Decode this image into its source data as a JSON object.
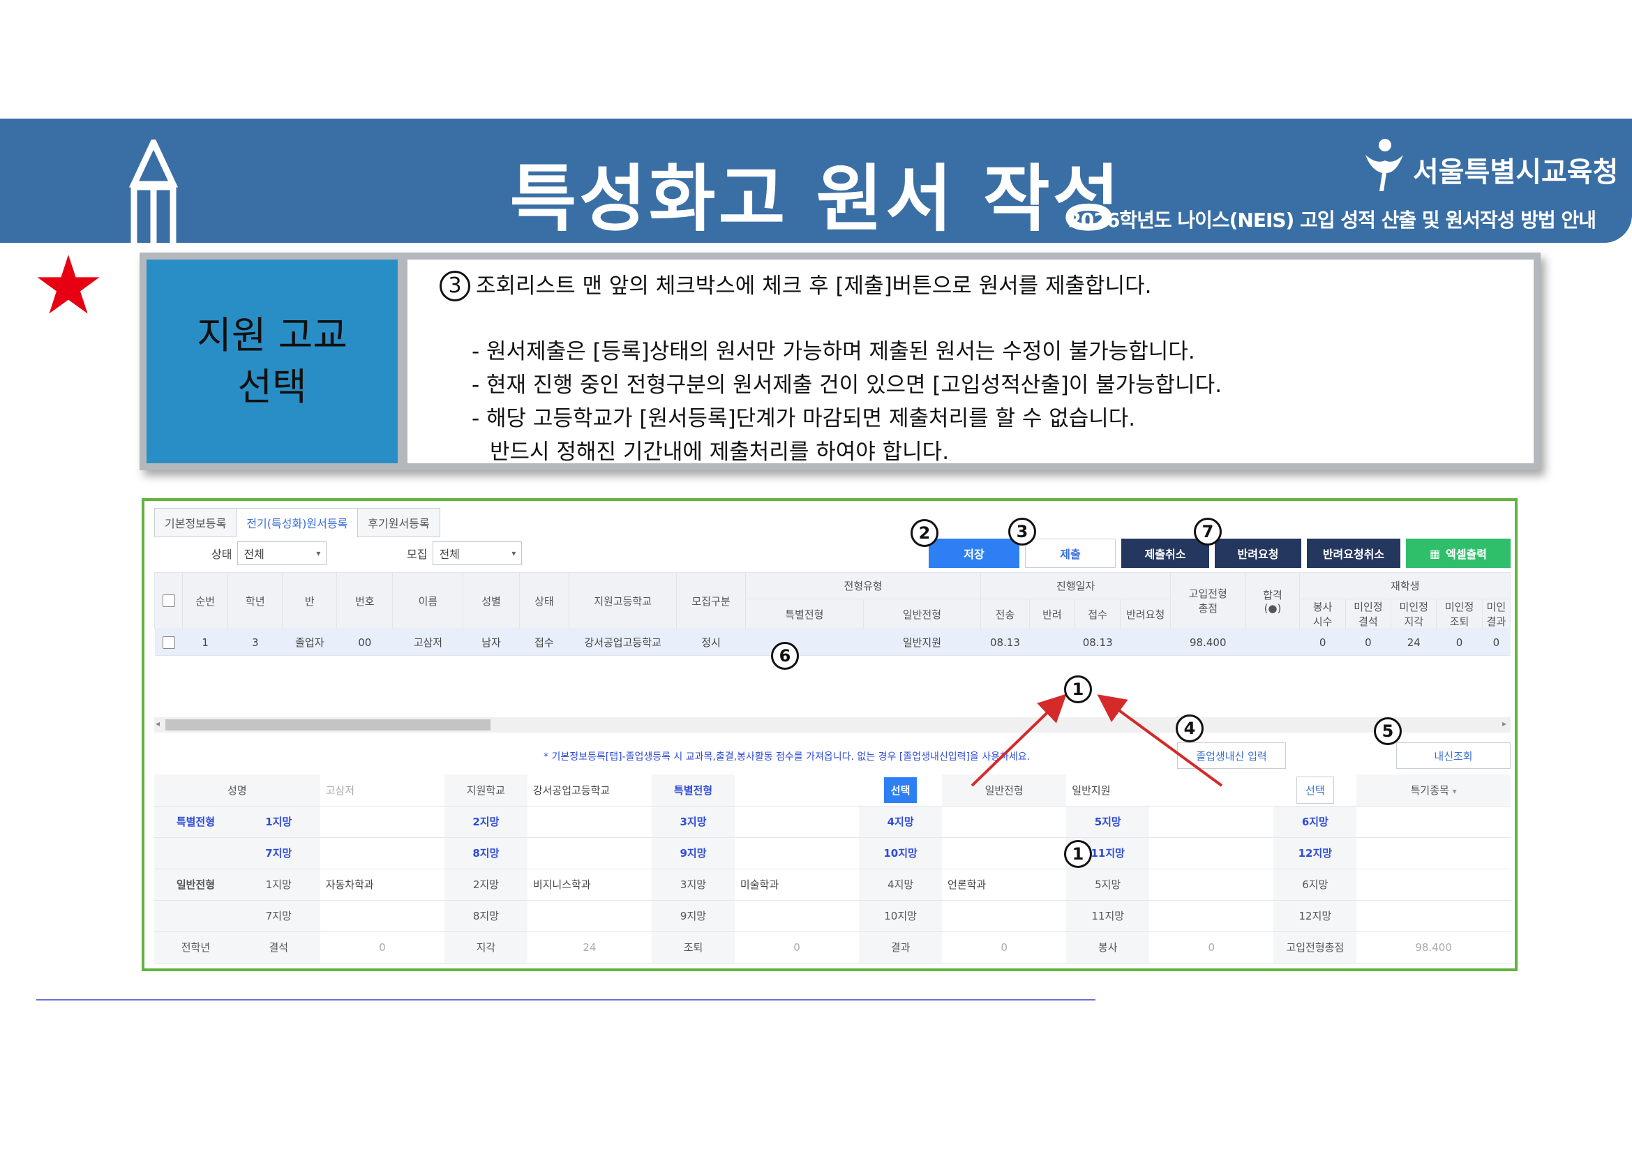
{
  "banner": {
    "title": "특성화고 원서 작성",
    "org_name": "서울특별시교육청",
    "subtitle": "2026학년도 나이스(NEIS) 고입 성적 산출 및 원서작성 방법 안내"
  },
  "step": {
    "label_line1": "지원 고교",
    "label_line2": "선택",
    "main_num": "3",
    "main_text": "조회리스트 맨 앞의 체크박스에 체크 후 [제출]버튼으로 원서를 제출합니다.",
    "bullets": [
      "- 원서제출은 [등록]상태의 원서만 가능하며 제출된 원서는 수정이 불가능합니다.",
      "- 현재 진행 중인 전형구분의 원서제출 건이 있으면 [고입성적산출]이 불가능합니다.",
      "- 해당 고등학교가 [원서등록]단계가 마감되면 제출처리를 할 수 없습니다."
    ],
    "bullet_cont": "반드시 정해진 기간내에 제출처리를 하여야 합니다."
  },
  "tabs": [
    "기본정보등록",
    "전기(특성화)원서등록",
    "후기원서등록"
  ],
  "filters": {
    "status_label": "상태",
    "status_value": "전체",
    "recruit_label": "모집",
    "recruit_value": "전체"
  },
  "buttons": {
    "save": "저장",
    "submit": "제출",
    "cancel_submit": "제출취소",
    "return_request": "반려요청",
    "cancel_return": "반려요청취소",
    "excel": "엑셀출력",
    "grad_grade": "졸업생내신 입력",
    "grade_view": "내신조회"
  },
  "badges": {
    "b1": "1",
    "b2": "2",
    "b3": "3",
    "b4": "4",
    "b5": "5",
    "b6": "6",
    "b7": "7"
  },
  "grid": {
    "group_headers": {
      "type": "전형유형",
      "date": "진행일자",
      "school": "재학생"
    },
    "headers": {
      "seq": "순번",
      "grade": "학년",
      "cls": "반",
      "num": "번호",
      "name": "이름",
      "gender": "성별",
      "status": "상태",
      "school": "지원고등학교",
      "recruit": "모집구분",
      "special": "특별전형",
      "general": "일반전형",
      "sent": "전송",
      "returned": "반려",
      "received": "접수",
      "ret_req": "반려요청",
      "total1": "고입전형",
      "total2": "총점",
      "pass1": "합격",
      "pass2": "(●)",
      "svc1": "봉사",
      "svc2": "시수",
      "abs1": "미인정",
      "abs2": "결석",
      "late1": "미인정",
      "late2": "지각",
      "early1": "미인정",
      "early2": "조퇴",
      "skip1": "미인",
      "skip2": "결과"
    },
    "row": {
      "seq": "1",
      "grade": "3",
      "cls": "졸업자",
      "num": "00",
      "name": "고삼저",
      "gender": "남자",
      "status": "접수",
      "school": "강서공업고등학교",
      "recruit": "정시",
      "special": "",
      "general": "일반지원",
      "sent": "08.13",
      "returned": "",
      "received": "08.13",
      "ret_req": "",
      "total": "98.400",
      "pass": "",
      "svc": "0",
      "abs": "0",
      "late": "24",
      "early": "0",
      "skip": "0"
    }
  },
  "note": "* 기본정보등록[탭]-졸업생등록 시 교과목,출결,봉사활동 점수를 가져옵니다. 없는 경우 [졸업생내신입력]을 사용하세요.",
  "form": {
    "name_label": "성명",
    "name_value": "고삼저",
    "school_label": "지원학교",
    "school_value": "강서공업고등학교",
    "special_label": "특별전형",
    "special_pick": "선택",
    "general_label": "일반전형",
    "general_value": "일반지원",
    "general_pick": "선택",
    "talent_label": "특기종목",
    "special_row": {
      "title": "특별전형",
      "r1": [
        "1지망",
        "2지망",
        "3지망",
        "4지망",
        "5지망",
        "6지망"
      ],
      "r2": [
        "7지망",
        "8지망",
        "9지망",
        "10지망",
        "11지망",
        "12지망"
      ]
    },
    "general_row": {
      "title": "일반전형",
      "r1": [
        "1지망",
        "2지망",
        "3지망",
        "4지망",
        "5지망",
        "6지망"
      ],
      "r1v": [
        "자동차학과",
        "비지니스학과",
        "미술학과",
        "언론학과",
        "",
        ""
      ],
      "r2": [
        "7지망",
        "8지망",
        "9지망",
        "10지망",
        "11지망",
        "12지망"
      ]
    },
    "prev_year": "전학년",
    "stats": [
      {
        "label": "결석",
        "value": "0"
      },
      {
        "label": "지각",
        "value": "24"
      },
      {
        "label": "조퇴",
        "value": "0"
      },
      {
        "label": "결과",
        "value": "0"
      },
      {
        "label": "봉사",
        "value": "0"
      },
      {
        "label": "고입전형총점",
        "value": "98.400"
      }
    ]
  },
  "colors": {
    "banner": "#3a6fa5",
    "label_box": "#2a8ec6",
    "frame": "#63b33f",
    "star": "#e60012",
    "arrow": "#d42a2a"
  },
  "icons": [
    "pencil-icon",
    "seoul-edu-logo",
    "star-icon",
    "excel-icon",
    "chevron-down-icon"
  ]
}
